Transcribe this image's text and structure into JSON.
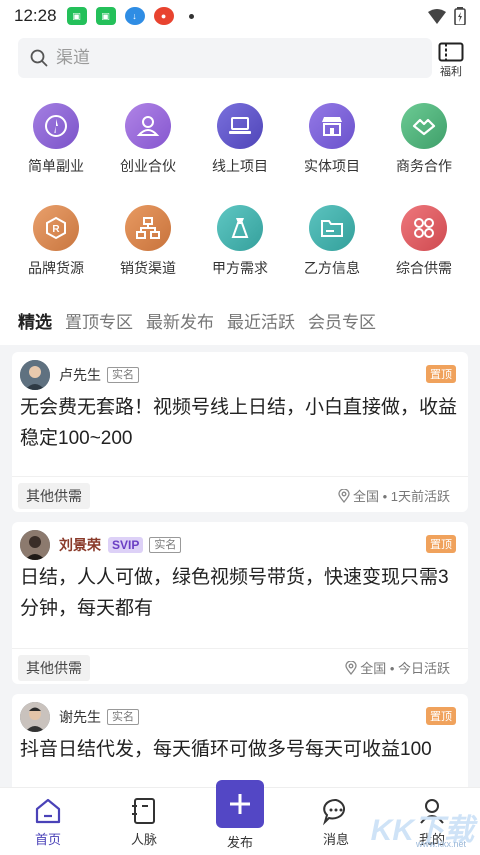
{
  "status_bar": {
    "time": "12:28"
  },
  "search": {
    "placeholder": "渠道"
  },
  "welfare": {
    "label": "福利"
  },
  "categories": [
    {
      "label": "简单副业",
      "icon": "compass-icon",
      "color": "#8a63d2"
    },
    {
      "label": "创业合伙",
      "icon": "partner-icon",
      "color": "#9a68d9"
    },
    {
      "label": "线上项目",
      "icon": "laptop-icon",
      "color": "#6158c9"
    },
    {
      "label": "实体项目",
      "icon": "store-icon",
      "color": "#7a62d6"
    },
    {
      "label": "商务合作",
      "icon": "handshake-icon",
      "color": "#4fb37d"
    },
    {
      "label": "品牌货源",
      "icon": "brand-icon",
      "color": "#d98a55"
    },
    {
      "label": "销货渠道",
      "icon": "channel-icon",
      "color": "#d9854f"
    },
    {
      "label": "甲方需求",
      "icon": "demand-icon",
      "color": "#45b3b0"
    },
    {
      "label": "乙方信息",
      "icon": "folder-icon",
      "color": "#42aaa6"
    },
    {
      "label": "综合供需",
      "icon": "grid-icon",
      "color": "#e25c62"
    }
  ],
  "tabs": [
    "精选",
    "置顶专区",
    "最新发布",
    "最近活跃",
    "会员专区"
  ],
  "posts": [
    {
      "name": "卢先生",
      "svip": "",
      "real": "实名",
      "pin": "置顶",
      "title": "无会费无套路！视频号线上日结，小白直接做，收益稳定100~200",
      "tag": "其他供需",
      "meta": "全国 • 1天前活跃"
    },
    {
      "name": "刘景荣",
      "svip": "SVIP",
      "real": "实名",
      "pin": "置顶",
      "title": "日结，人人可做，绿色视频号带货，快速变现只需3分钟，每天都有",
      "tag": "其他供需",
      "meta": "全国 • 今日活跃"
    },
    {
      "name": "谢先生",
      "svip": "",
      "real": "实名",
      "pin": "置顶",
      "title": "抖音日结代发，每天循环可做多号每天可收益100",
      "tag": "",
      "meta": ""
    }
  ],
  "tabbar": {
    "home": "首页",
    "contacts": "人脉",
    "publish": "发布",
    "messages": "消息",
    "mine": "我的"
  },
  "watermark": {
    "big": "KK下载",
    "small": "www.kkx.net"
  },
  "colors": {
    "accent": "#5347c5",
    "pin": "#f0a25c",
    "svip_bg": "#ddd1f7"
  }
}
